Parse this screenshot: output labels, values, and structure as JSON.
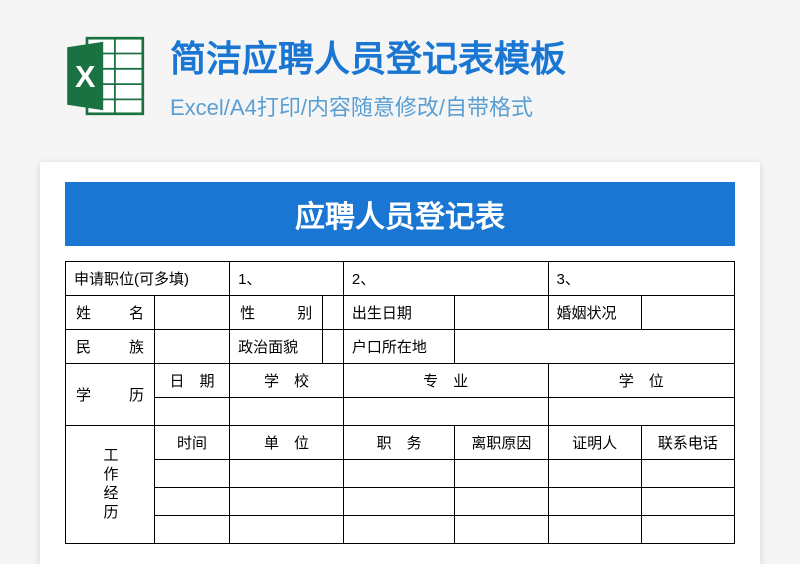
{
  "header": {
    "title": "简洁应聘人员登记表模板",
    "subtitle": "Excel/A4打印/内容随意修改/自带格式",
    "icon_letter": "X"
  },
  "form": {
    "title": "应聘人员登记表",
    "apply_position_label": "申请职位(可多填)",
    "pos1": "1、",
    "pos2": "2、",
    "pos3": "3、",
    "name_label": "姓　名",
    "gender_label": "性　别",
    "birth_label": "出生日期",
    "marital_label": "婚姻状况",
    "ethnicity_label": "民　族",
    "political_label": "政治面貌",
    "hukou_label": "户口所在地",
    "edu_group_label": "学　历",
    "edu_date": "日　期",
    "edu_school": "学　校",
    "edu_major": "专　业",
    "edu_degree": "学　位",
    "work_group_label": "工作经历",
    "work_time": "时间",
    "work_unit": "单　位",
    "work_position": "职　务",
    "work_reason": "离职原因",
    "work_reference": "证明人",
    "work_phone": "联系电话"
  }
}
